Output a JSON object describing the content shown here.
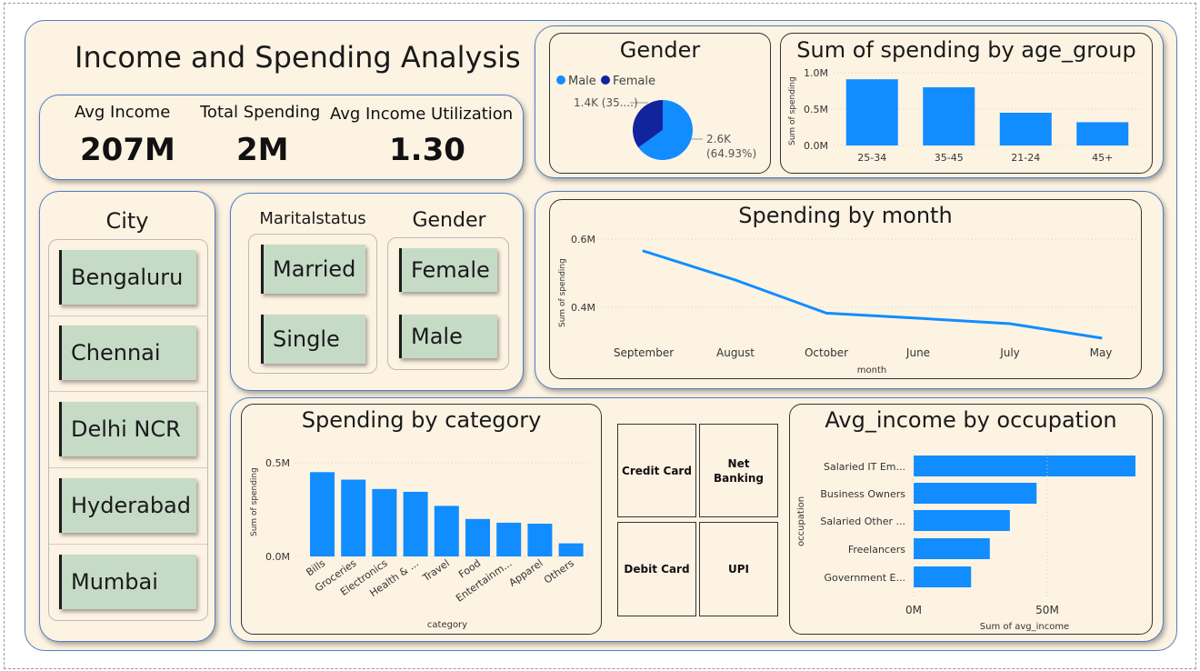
{
  "header": {
    "title": "Income and Spending Analysis"
  },
  "kpis": [
    {
      "label": "Avg Income",
      "value": "207M"
    },
    {
      "label": "Total Spending",
      "value": "2M"
    },
    {
      "label": "Avg Income Utilization",
      "value": "1.30"
    }
  ],
  "city_slicer": {
    "title": "City",
    "items": [
      "Bengaluru",
      "Chennai",
      "Delhi NCR",
      "Hyderabad",
      "Mumbai"
    ]
  },
  "marital_slicer": {
    "title": "Maritalstatus",
    "items": [
      "Married",
      "Single"
    ]
  },
  "gender_slicer": {
    "title": "Gender",
    "items": [
      "Female",
      "Male"
    ]
  },
  "payment_tiles": [
    "Credit Card",
    "Net Banking",
    "Debit Card",
    "UPI"
  ],
  "colors": {
    "bar": "#118dff",
    "dark": "#12239e",
    "slicer": "#c5dbc6",
    "background": "#fdf3e3",
    "border": "#4f7fc3"
  },
  "chart_data": [
    {
      "id": "gender_pie",
      "type": "pie",
      "title": "Gender",
      "legend": [
        "Male",
        "Female"
      ],
      "legend_position": "top-left",
      "slices": [
        {
          "name": "Male",
          "value": 2.6,
          "label": "2.6K",
          "pct_label": "(64.93%)",
          "color": "#118dff"
        },
        {
          "name": "Female",
          "value": 1.4,
          "label": "1.4K (35....)",
          "color": "#12239e"
        }
      ]
    },
    {
      "id": "age_bar",
      "type": "bar",
      "title": "Sum of spending by age_group",
      "ylabel": "Sum of spending",
      "categories": [
        "25-34",
        "35-45",
        "21-24",
        "45+"
      ],
      "values": [
        0.91,
        0.8,
        0.45,
        0.32
      ],
      "ylim": [
        0,
        1.0
      ],
      "yticks": [
        {
          "v": 0,
          "label": "0.0M"
        },
        {
          "v": 0.5,
          "label": "0.5M"
        },
        {
          "v": 1.0,
          "label": "1.0M"
        }
      ]
    },
    {
      "id": "month_line",
      "type": "line",
      "title": "Spending by month",
      "xlabel": "month",
      "ylabel": "Sum of spending",
      "categories": [
        "September",
        "August",
        "October",
        "June",
        "July",
        "May"
      ],
      "values": [
        0.565,
        0.48,
        0.383,
        0.368,
        0.352,
        0.31
      ],
      "ylim": [
        0.3,
        0.6
      ],
      "yticks": [
        {
          "v": 0.4,
          "label": "0.4M"
        },
        {
          "v": 0.6,
          "label": "0.6M"
        }
      ],
      "grid": true
    },
    {
      "id": "category_bar",
      "type": "bar",
      "title": "Spending by category",
      "xlabel": "category",
      "ylabel": "Sum of spending",
      "categories": [
        "Bills",
        "Groceries",
        "Electronics",
        "Health & ...",
        "Travel",
        "Food",
        "Entertainm...",
        "Apparel",
        "Others"
      ],
      "values": [
        0.45,
        0.41,
        0.36,
        0.345,
        0.27,
        0.2,
        0.18,
        0.175,
        0.07
      ],
      "ylim": [
        0,
        0.5
      ],
      "yticks": [
        {
          "v": 0,
          "label": "0.0M"
        },
        {
          "v": 0.5,
          "label": "0.5M"
        }
      ]
    },
    {
      "id": "occupation_bar",
      "type": "bar",
      "orientation": "horizontal",
      "title": "Avg_income by occupation",
      "xlabel": "Sum of avg_income",
      "ylabel": "occupation",
      "categories": [
        "Salaried IT Em...",
        "Business Owners",
        "Salaried Other ...",
        "Freelancers",
        "Government E..."
      ],
      "values": [
        83,
        46,
        36,
        28.5,
        21.5
      ],
      "xlim": [
        0,
        83
      ],
      "xticks": [
        {
          "v": 0,
          "label": "0M"
        },
        {
          "v": 50,
          "label": "50M"
        }
      ]
    }
  ]
}
